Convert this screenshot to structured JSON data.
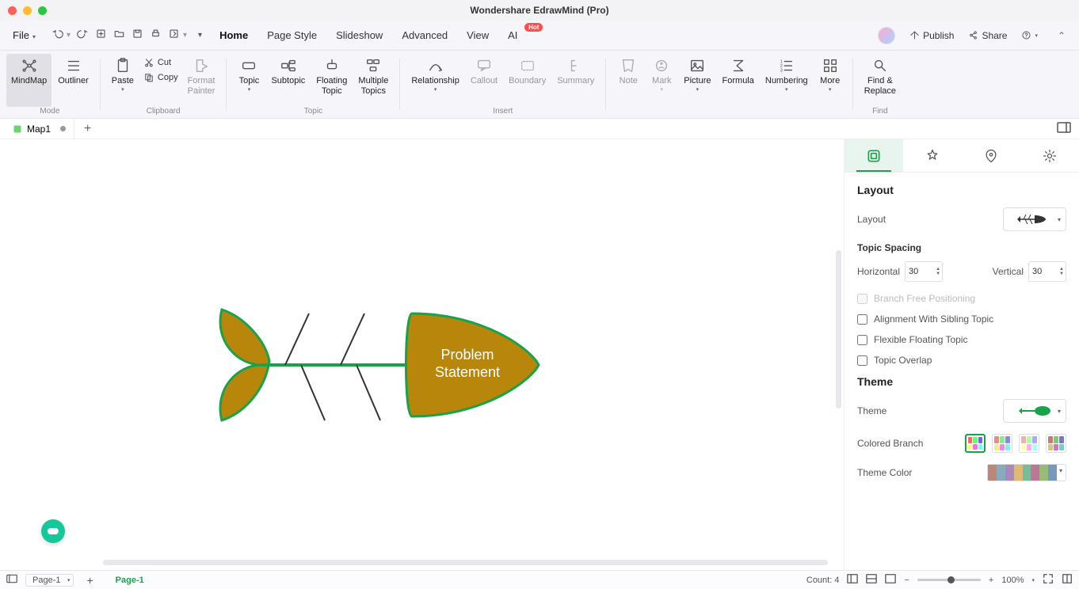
{
  "title": "Wondershare EdrawMind (Pro)",
  "menubar": {
    "file": "File",
    "tabs": {
      "home": "Home",
      "pagestyle": "Page Style",
      "slideshow": "Slideshow",
      "advanced": "Advanced",
      "view": "View",
      "ai": "AI",
      "ai_badge": "Hot"
    },
    "publish": "Publish",
    "share": "Share"
  },
  "ribbon": {
    "mode_lbl": "Mode",
    "mindmap": "MindMap",
    "outliner": "Outliner",
    "clipboard_lbl": "Clipboard",
    "paste": "Paste",
    "cut": "Cut",
    "copy": "Copy",
    "format_painter": "Format\nPainter",
    "topic_lbl": "Topic",
    "topic": "Topic",
    "subtopic": "Subtopic",
    "floating": "Floating\nTopic",
    "multiple": "Multiple\nTopics",
    "insert_lbl": "Insert",
    "relationship": "Relationship",
    "callout": "Callout",
    "boundary": "Boundary",
    "summary": "Summary",
    "note": "Note",
    "mark": "Mark",
    "picture": "Picture",
    "formula": "Formula",
    "numbering": "Numbering",
    "more": "More",
    "find_lbl": "Find",
    "findreplace": "Find &\nReplace"
  },
  "doctab": {
    "name": "Map1"
  },
  "canvas": {
    "main_topic": "Problem\nStatement"
  },
  "panel": {
    "layout_h": "Layout",
    "layout_lbl": "Layout",
    "spacing_h": "Topic Spacing",
    "horizontal": "Horizontal",
    "h_val": "30",
    "vertical": "Vertical",
    "v_val": "30",
    "branch_free": "Branch Free Positioning",
    "align_sibling": "Alignment With Sibling Topic",
    "flex_float": "Flexible Floating Topic",
    "overlap": "Topic Overlap",
    "theme_h": "Theme",
    "theme_lbl": "Theme",
    "colored_branch": "Colored Branch",
    "theme_color": "Theme Color"
  },
  "status": {
    "page_dd": "Page-1",
    "page_tab": "Page-1",
    "count": "Count: 4",
    "zoom": "100%"
  }
}
